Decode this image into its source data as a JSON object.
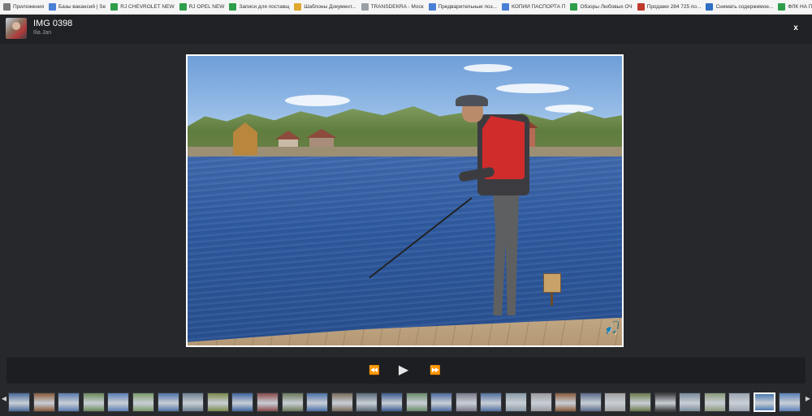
{
  "bookmarks": [
    {
      "label": "Приложения",
      "color": "#7a7a7a"
    },
    {
      "label": "Базы вакансий | Se",
      "color": "#4a7fd6"
    },
    {
      "label": "RJ CHEVROLET NEW",
      "color": "#2e9e4a"
    },
    {
      "label": "RJ OPEL NEW",
      "color": "#2e9e4a"
    },
    {
      "label": "Записи для поставщ",
      "color": "#2e9e4a"
    },
    {
      "label": "Шаблоны Документ...",
      "color": "#e0a82e"
    },
    {
      "label": "TRANSDEKRA - Моск",
      "color": "#9aa0a6"
    },
    {
      "label": "Предварительные поз...",
      "color": "#4a7fd6"
    },
    {
      "label": "КОПИИ ПАСПОРТА П",
      "color": "#4a7fd6"
    },
    {
      "label": "Обзоры Любовых ОЧ",
      "color": "#2e9e4a"
    },
    {
      "label": "Продажи 284 725 по...",
      "color": "#c0392b"
    },
    {
      "label": "Снимать содержимое...",
      "color": "#2f6fc4"
    },
    {
      "label": "ФЛК НА ПРИЕМ",
      "color": "#2e9e4a"
    }
  ],
  "viewer": {
    "title": "IMG 0398",
    "subtitle": "Ilia Jan",
    "close_label": "x"
  },
  "controls": {
    "rewind_icon": "⏪",
    "play_icon": "▶",
    "forward_icon": "⏩"
  },
  "filmstrip": {
    "left_arrow": "◀",
    "right_arrow": "▶",
    "thumbs": [
      {
        "color": "#4a6a9a",
        "active": false
      },
      {
        "color": "#8a5a3a",
        "active": false
      },
      {
        "color": "#5a7ab0",
        "active": false
      },
      {
        "color": "#6a8a5a",
        "active": false
      },
      {
        "color": "#5b7fb5",
        "active": false
      },
      {
        "color": "#7a9a6a",
        "active": false
      },
      {
        "color": "#4f73a8",
        "active": false
      },
      {
        "color": "#6d7f8f",
        "active": false
      },
      {
        "color": "#7a8a4a",
        "active": false
      },
      {
        "color": "#3f65a0",
        "active": false
      },
      {
        "color": "#8a4a4a",
        "active": false
      },
      {
        "color": "#6a7a5a",
        "active": false
      },
      {
        "color": "#4a70a8",
        "active": false
      },
      {
        "color": "#7a6a5a",
        "active": false
      },
      {
        "color": "#5a6a7a",
        "active": false
      },
      {
        "color": "#3a5a90",
        "active": false
      },
      {
        "color": "#6a8a6a",
        "active": false
      },
      {
        "color": "#4a6aa0",
        "active": false
      },
      {
        "color": "#7a7a8a",
        "active": false
      },
      {
        "color": "#5070a0",
        "active": false
      },
      {
        "color": "#8a9aa8",
        "active": false
      },
      {
        "color": "#9a9aa0",
        "active": false
      },
      {
        "color": "#8a5a3a",
        "active": false
      },
      {
        "color": "#5a6a8a",
        "active": false
      },
      {
        "color": "#a0a0a0",
        "active": false
      },
      {
        "color": "#6a7a4a",
        "active": false
      },
      {
        "color": "#3a3a3a",
        "active": false
      },
      {
        "color": "#7a8a9a",
        "active": false
      },
      {
        "color": "#8a9a7a",
        "active": false
      },
      {
        "color": "#9aa4b0",
        "active": false
      },
      {
        "color": "#4a7ab0",
        "active": true
      },
      {
        "color": "#5a80b8",
        "active": false
      }
    ]
  }
}
